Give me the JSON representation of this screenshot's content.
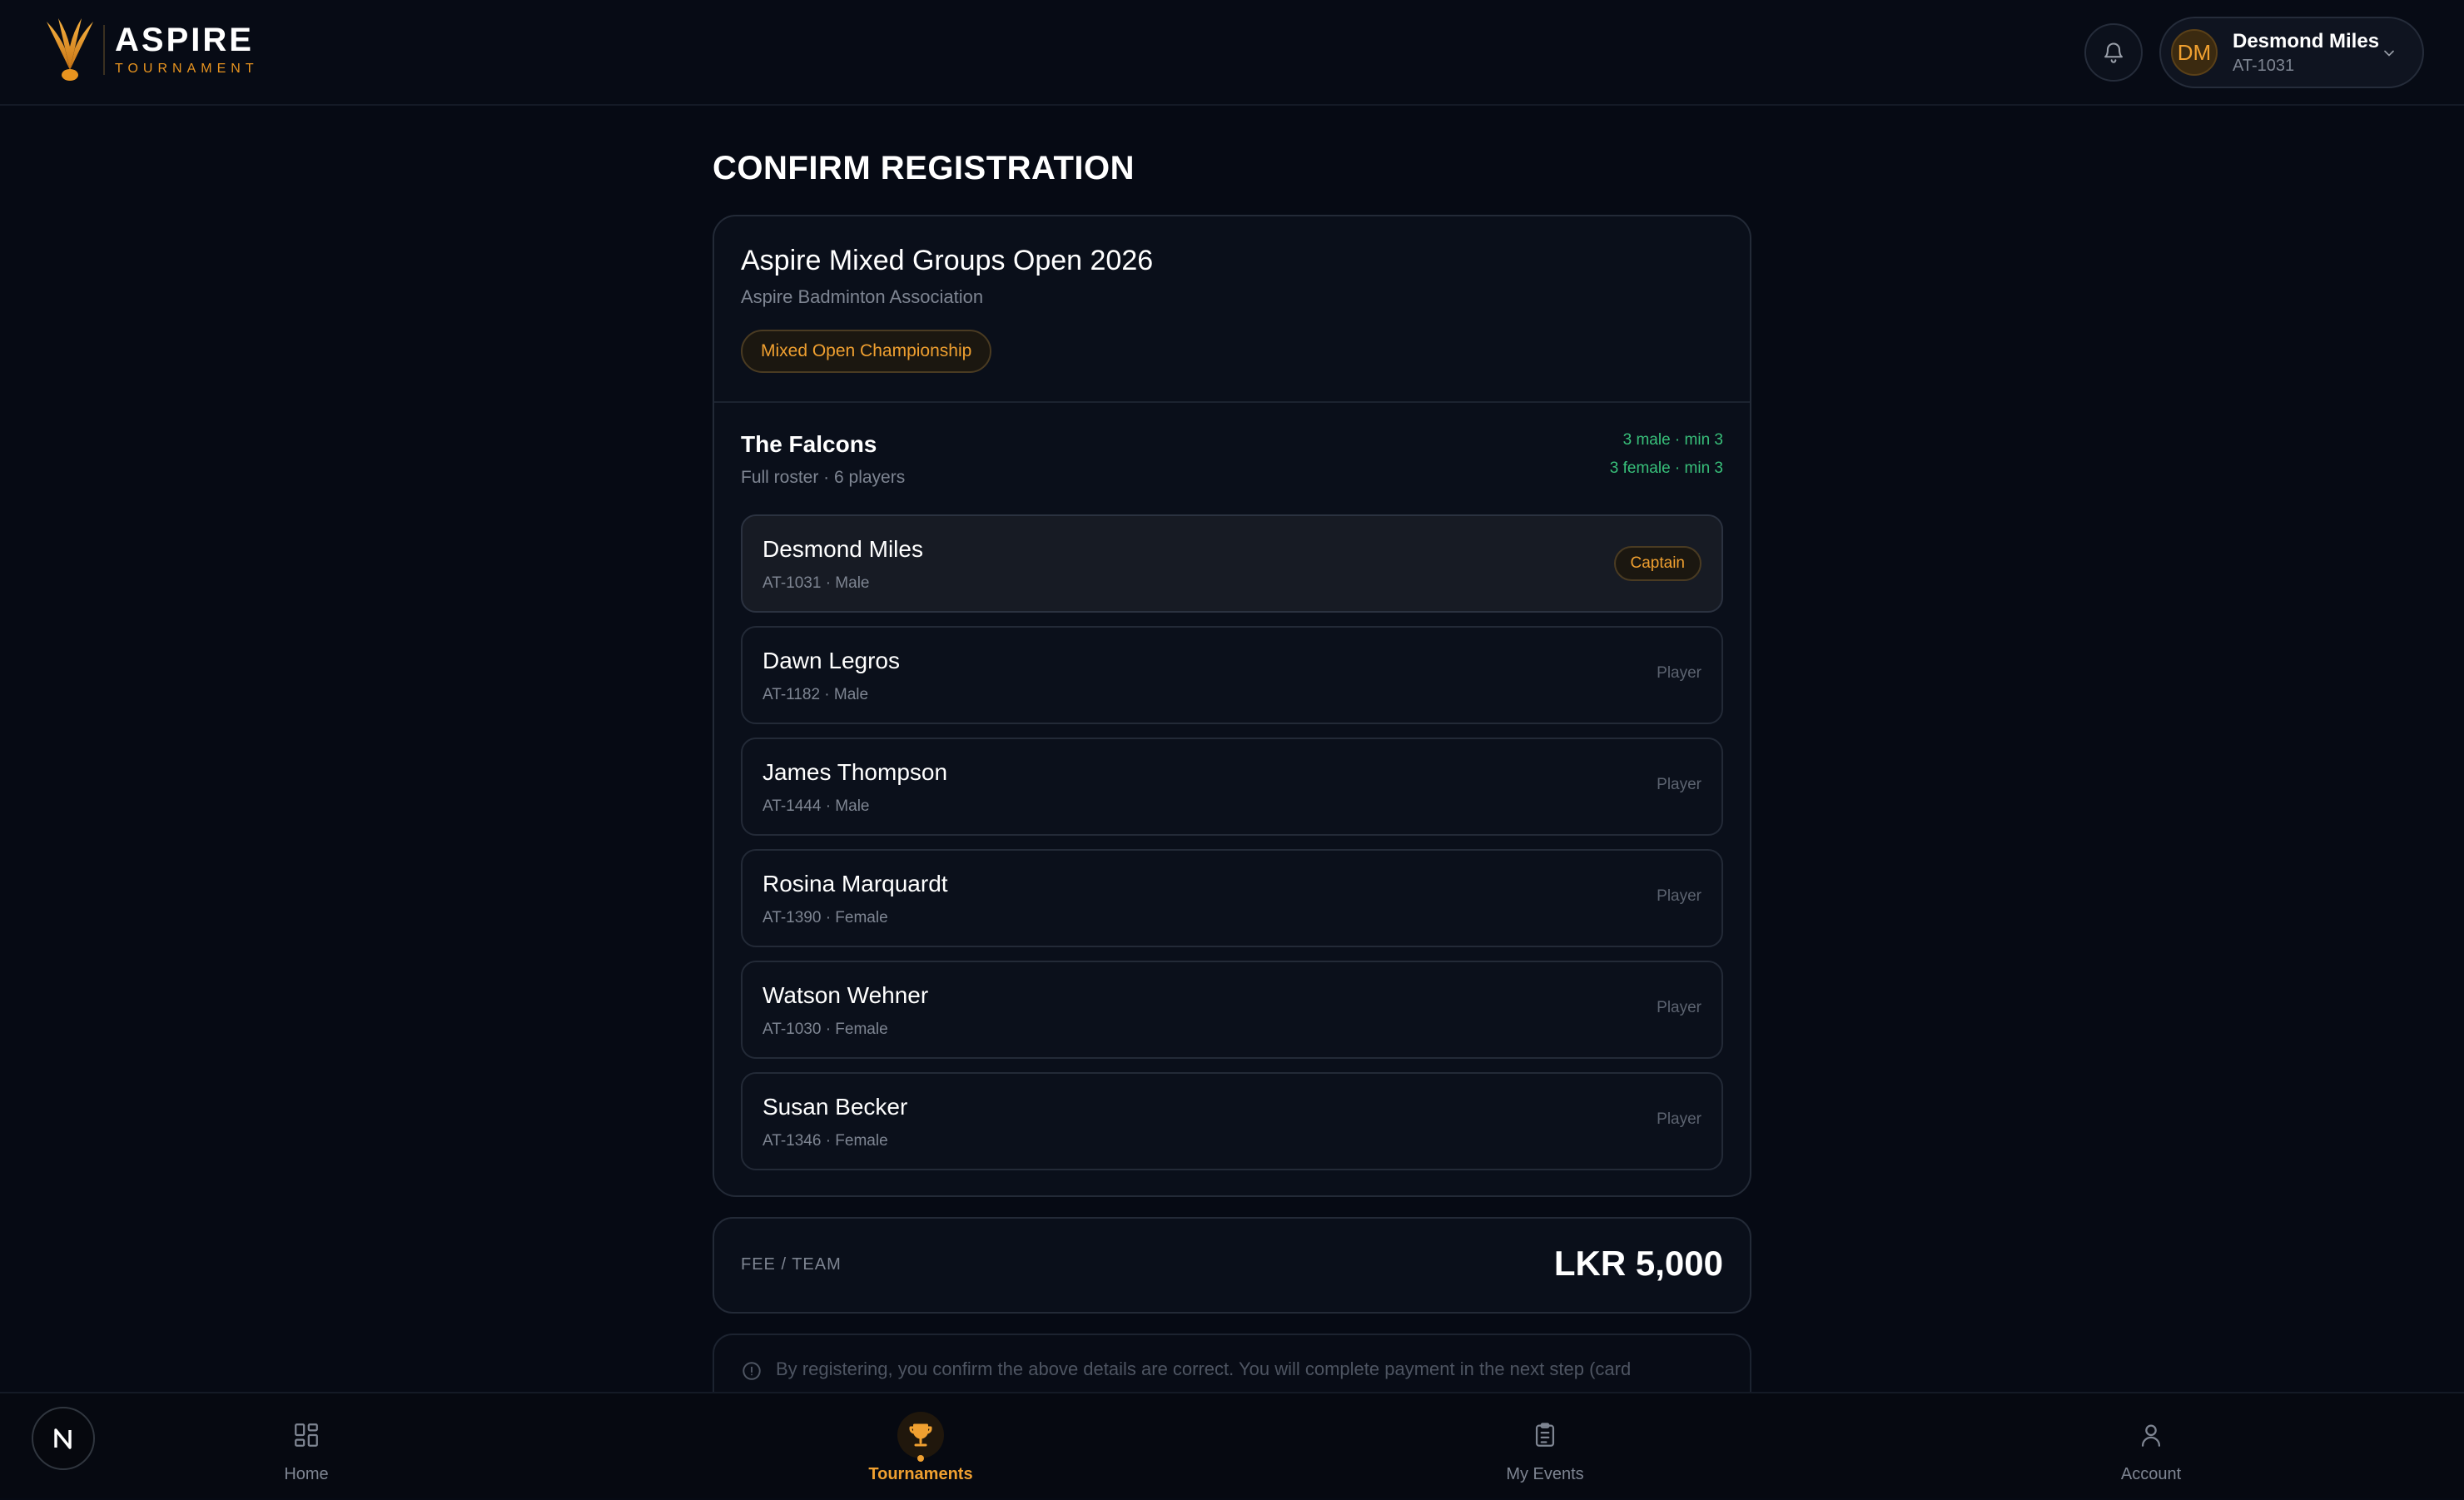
{
  "brand": {
    "title": "ASPIRE",
    "subtitle": "TOURNAMENT"
  },
  "user": {
    "initials": "DM",
    "name": "Desmond Miles",
    "id": "AT-1031"
  },
  "page": {
    "title": "CONFIRM REGISTRATION"
  },
  "tournament": {
    "title": "Aspire Mixed Groups Open 2026",
    "organizer": "Aspire Badminton Association",
    "category": "Mixed Open Championship"
  },
  "team": {
    "name": "The Falcons",
    "summary": "Full roster · 6 players",
    "male_requirement": "3 male · min 3",
    "female_requirement": "3 female · min 3",
    "players": [
      {
        "name": "Desmond Miles",
        "meta": "AT-1031 · Male",
        "role": "Captain"
      },
      {
        "name": "Dawn Legros",
        "meta": "AT-1182 · Male",
        "role": "Player"
      },
      {
        "name": "James Thompson",
        "meta": "AT-1444 · Male",
        "role": "Player"
      },
      {
        "name": "Rosina Marquardt",
        "meta": "AT-1390 · Female",
        "role": "Player"
      },
      {
        "name": "Watson Wehner",
        "meta": "AT-1030 · Female",
        "role": "Player"
      },
      {
        "name": "Susan Becker",
        "meta": "AT-1346 · Female",
        "role": "Player"
      }
    ]
  },
  "fee": {
    "label": "FEE / TEAM",
    "amount": "LKR 5,000"
  },
  "notice": {
    "text": "By registering, you confirm the above details are correct. You will complete payment in the next step (card"
  },
  "nav": {
    "fab_label": "N",
    "items": [
      {
        "label": "Home",
        "icon": "grid-icon",
        "active": false
      },
      {
        "label": "Tournaments",
        "icon": "trophy-icon",
        "active": true
      },
      {
        "label": "My Events",
        "icon": "clipboard-icon",
        "active": false
      },
      {
        "label": "Account",
        "icon": "user-icon",
        "active": false
      }
    ]
  },
  "colors": {
    "accent": "#f0a030",
    "success": "#38c07a",
    "background": "#060a14"
  }
}
